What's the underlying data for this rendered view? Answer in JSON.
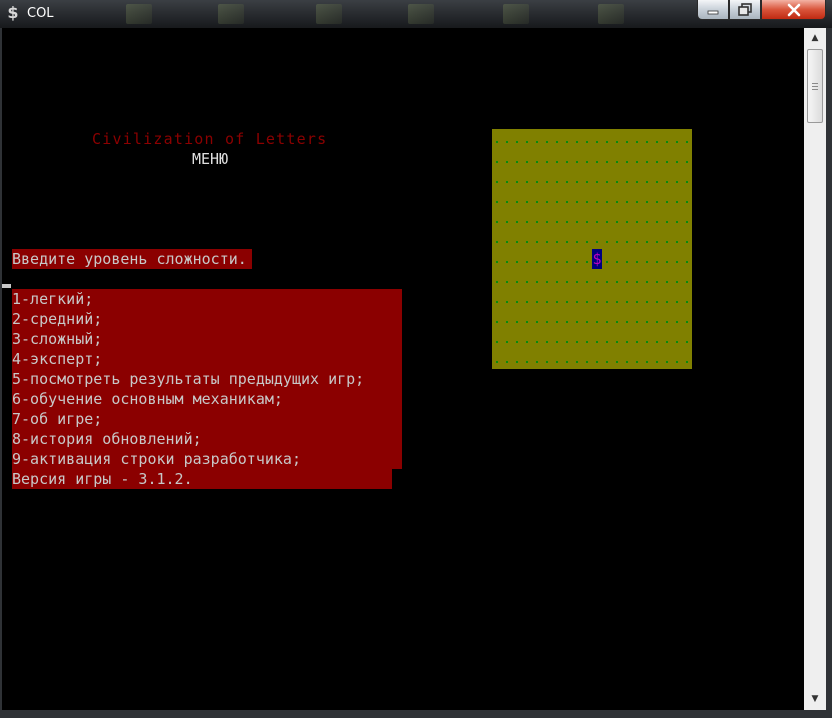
{
  "window": {
    "title": "COL",
    "app_icon": "dollar-icon",
    "controls": {
      "minimize_icon": "minimize-icon",
      "maximize_icon": "maximize-icon",
      "close_icon": "close-icon"
    }
  },
  "console": {
    "game_title": "Civilization of Letters",
    "menu_heading": "МЕНЮ",
    "prompt": "Введите уровень сложности.",
    "options": [
      "1-легкий;",
      "2-средний;",
      "3-сложный;",
      "4-эксперт;",
      "5-посмотреть результаты предыдущих игр;",
      "6-обучение основным механикам;",
      "7-об игре;",
      "8-история обновлений;",
      "9-активация строки разработчика;",
      "Версия игры - 3.1.2."
    ]
  },
  "map": {
    "columns": 20,
    "rows": 12,
    "player_symbol": "$",
    "player_cell": {
      "col": 10,
      "row": 6
    }
  },
  "colors": {
    "console_bg": "#000000",
    "console_text": "#c8c8c8",
    "title_red": "#8b0000",
    "highlight_red": "#8b0000",
    "map_bg": "#808000",
    "map_dot": "#0a8a0a",
    "player_bg": "#000080",
    "player_fg": "#c000c0"
  }
}
